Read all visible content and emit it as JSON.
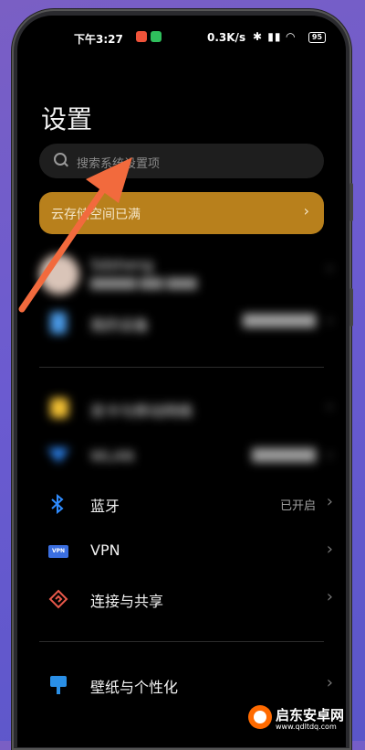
{
  "status_bar": {
    "time": "下午3:27",
    "speed": "0.3K/s",
    "icons": "✱ ▮▮ ◠",
    "battery": "95"
  },
  "page": {
    "title": "设置",
    "search_placeholder": "搜索系统设置项"
  },
  "banner": {
    "text": "云存储空间已满",
    "chevron": "›"
  },
  "account": {
    "name": "Sdsheng",
    "sub": "██████ ███ ████"
  },
  "rows": [
    {
      "label": "我的设备",
      "value": "████████",
      "blurred": true
    },
    {
      "label": "双卡与移动网络",
      "value": "",
      "blurred": true
    },
    {
      "label": "WLAN",
      "value": "███████",
      "blurred": true
    },
    {
      "label": "蓝牙",
      "value": "已开启",
      "blurred": false
    },
    {
      "label": "VPN",
      "value": "",
      "blurred": false
    },
    {
      "label": "连接与共享",
      "value": "",
      "blurred": false
    },
    {
      "label": "壁纸与个性化",
      "value": "",
      "blurred": false
    }
  ],
  "icons": {
    "bluetooth": "bluetooth-icon",
    "vpn": "vpn-icon",
    "share": "connection-share-icon",
    "wallpaper": "wallpaper-icon"
  },
  "colors": {
    "banner": "#b8801c",
    "arrow": "#f26a3d",
    "bluetooth": "#2f8cff",
    "vpn": "#3b6fe0"
  },
  "watermark": {
    "title": "启东安卓网",
    "url": "www.qdltdq.com"
  }
}
